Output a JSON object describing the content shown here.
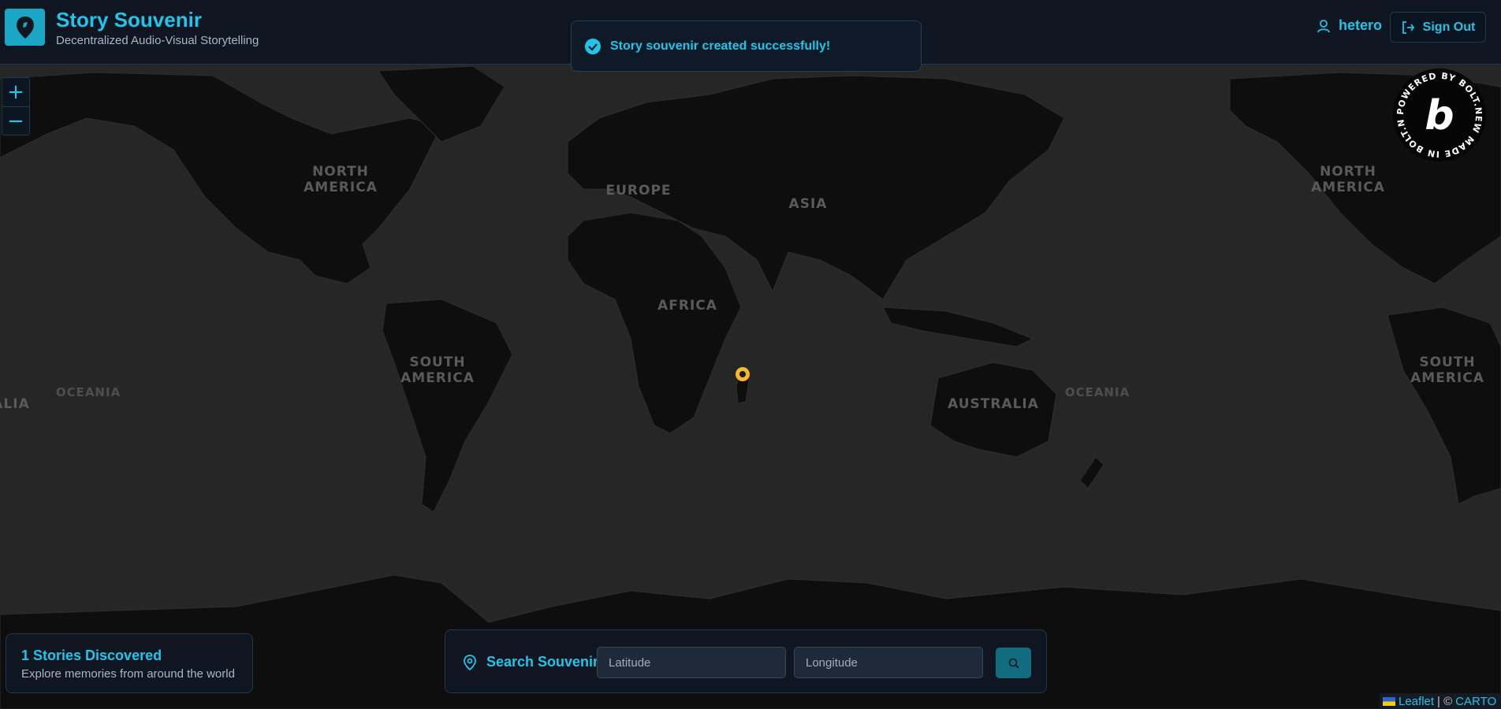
{
  "header": {
    "title": "Story Souvenir",
    "subtitle": "Decentralized Audio-Visual Storytelling",
    "username": "hetero",
    "signout_label": "Sign Out"
  },
  "toast": {
    "message": "Story souvenir created successfully!"
  },
  "map": {
    "zoom_in_label": "+",
    "zoom_out_label": "−",
    "labels": {
      "north_america_left": "NORTH\nAMERICA",
      "europe": "EUROPE",
      "asia": "ASIA",
      "africa": "AFRICA",
      "south_america_left": "SOUTH\nAMERICA",
      "oceania_left": "OCEANIA",
      "alia_left": "ALIA",
      "australia": "AUSTRALIA",
      "oceania_right": "OCEANIA",
      "north_america_right": "NORTH\nAMERICA",
      "south_america_right": "SOUTH\nAMERICA"
    },
    "marker_color": "#f5b82e"
  },
  "bolt_badge": {
    "ring_text": "POWERED BY BOLT.NEW MADE IN BOLT.NEW"
  },
  "stories": {
    "title": "1 Stories Discovered",
    "subtitle": "Explore memories from around the world"
  },
  "search": {
    "label": "Search Souvenir",
    "latitude_placeholder": "Latitude",
    "longitude_placeholder": "Longitude"
  },
  "attribution": {
    "leaflet": "Leaflet",
    "separator": "| ©",
    "carto": "CARTO"
  },
  "colors": {
    "accent": "#22c5e8",
    "header_bg": "#0f1622",
    "map_bg": "#262626",
    "land": "#0e0e0e"
  }
}
